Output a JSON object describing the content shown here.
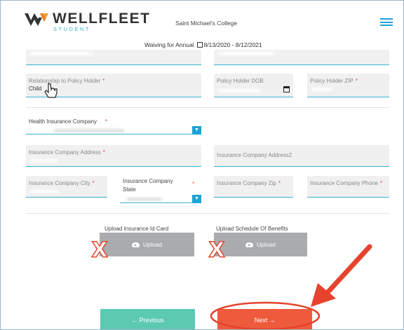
{
  "header": {
    "brand": "WELLFLEET",
    "brand_sub": "STUDENT",
    "college": "Saint Michael's College",
    "period_prefix": "Waiving for Annual",
    "period_range": "8/13/2020 - 8/12/2021"
  },
  "form": {
    "relationship": {
      "label": "Relationship to Policy Holder",
      "required": "*",
      "value": "Child"
    },
    "policy_dob": {
      "label": "Policy Holder DOB"
    },
    "policy_zip": {
      "label": "Policy Holder ZIP",
      "required": "*"
    },
    "insurance_company": {
      "label": "Health Insurance Company",
      "required": "*"
    },
    "company_address": {
      "label": "Insurance Company Address",
      "required": "*"
    },
    "company_address2": {
      "label": "Insurance Company Address2"
    },
    "company_city": {
      "label": "Insurance Company City",
      "required": "*"
    },
    "company_state": {
      "label": "Insurance Company State",
      "required": "*"
    },
    "company_zip": {
      "label": "Insurance Company Zip",
      "required": "*"
    },
    "company_phone": {
      "label": "Insurance Company Phone",
      "required": "*"
    }
  },
  "uploads": {
    "id_card": {
      "label": "Upload Insurance Id Card",
      "button": "Upload"
    },
    "benefits": {
      "label": "Upload Schedule Of Benefits",
      "button": "Upload"
    }
  },
  "annotations": {
    "x_mark": "X",
    "x_color": "#e5432d",
    "arrow_color": "#e5432d"
  },
  "nav": {
    "previous": "Previous",
    "next": "Next"
  },
  "colors": {
    "accent": "#1ea3d6",
    "prev_button": "#5cc9b1",
    "next_button": "#ee5a3c",
    "upload_button": "#a9abad"
  }
}
